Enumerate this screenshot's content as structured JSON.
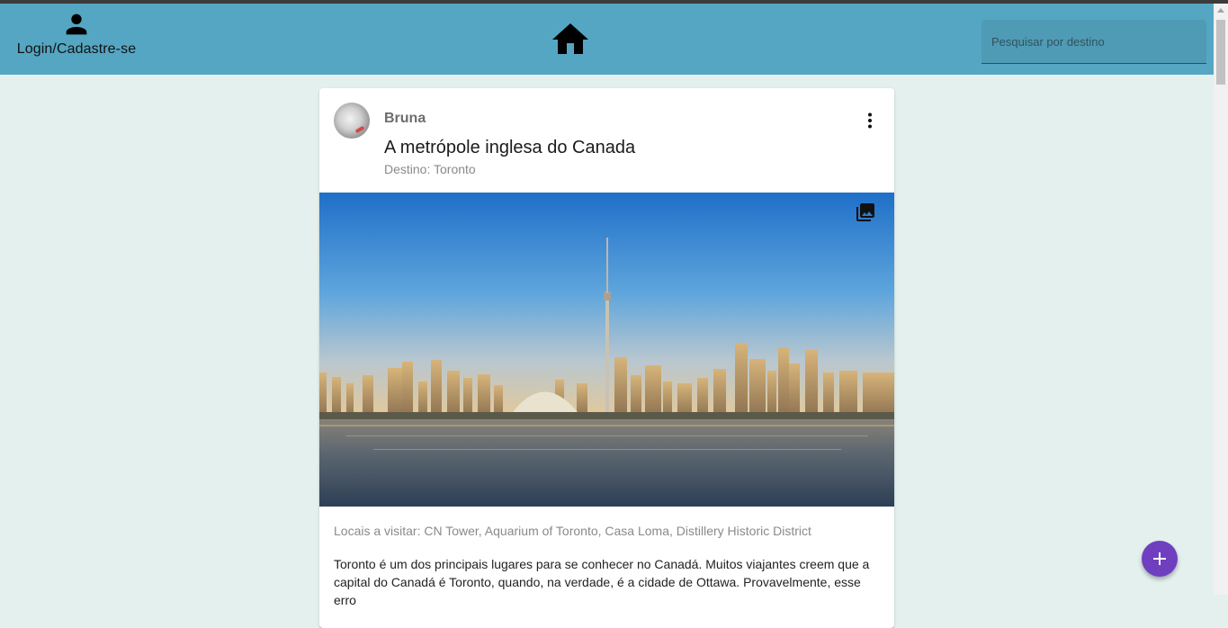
{
  "header": {
    "login_label": "Login/Cadastre-se",
    "search_placeholder": "Pesquisar por destino"
  },
  "post": {
    "author": "Bruna",
    "title": "A metrópole inglesa do Canada",
    "destination": "Destino: Toronto",
    "places": "Locais a visitar: CN Tower, Aquarium of Toronto, Casa Loma, Distillery Historic District",
    "description": "Toronto é um dos principais lugares para se conhecer no Canadá. Muitos viajantes creem que a capital do Canadá é Toronto, quando, na verdade, é a cidade de Ottawa. Provavelmente, esse erro"
  },
  "icons": {
    "login": "person-icon",
    "home": "home-icon",
    "menu": "more-vert-icon",
    "gallery": "photo-library-icon",
    "add": "add-icon"
  },
  "colors": {
    "appbar": "#55a6c2",
    "background": "#e3f0ee",
    "fab": "#6f3fc0"
  }
}
